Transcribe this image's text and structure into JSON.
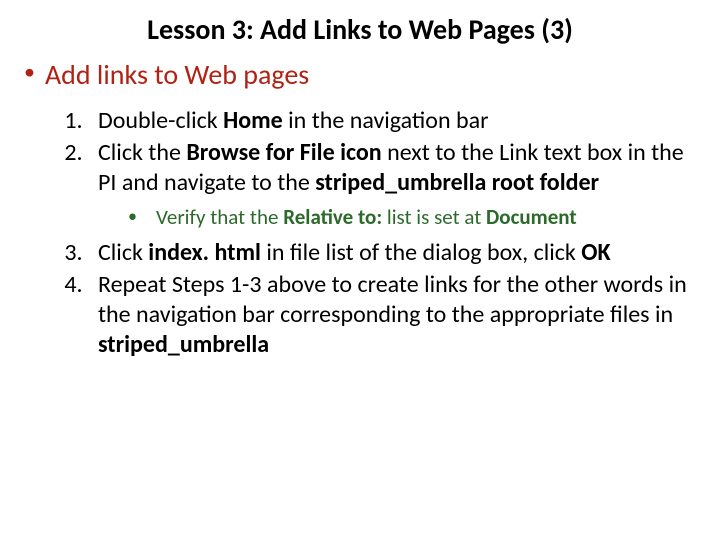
{
  "title": "Lesson 3: Add Links to Web Pages (3)",
  "main_bullet": "Add links to Web pages",
  "steps": {
    "s1": {
      "pre": "Double-click ",
      "b1": "Home",
      "post": " in the navigation bar"
    },
    "s2": {
      "a": "Click the ",
      "b1": "Browse for File icon ",
      "b": "next to the Link text box in the PI and navigate to the ",
      "b2": "striped_umbrella root folder"
    },
    "sub": {
      "a": "Verify that the ",
      "b1": "Relative to: ",
      "b": "list is set at ",
      "b2": "Document"
    },
    "s3": {
      "a": "Click ",
      "b1": "index. html ",
      "b": "in file list of the dialog box, click ",
      "b2": "OK"
    },
    "s4": {
      "a": "Repeat Steps 1-3 above to create links for the other words in the navigation bar corresponding to the appropriate files in ",
      "b1": "striped_umbrella"
    }
  }
}
